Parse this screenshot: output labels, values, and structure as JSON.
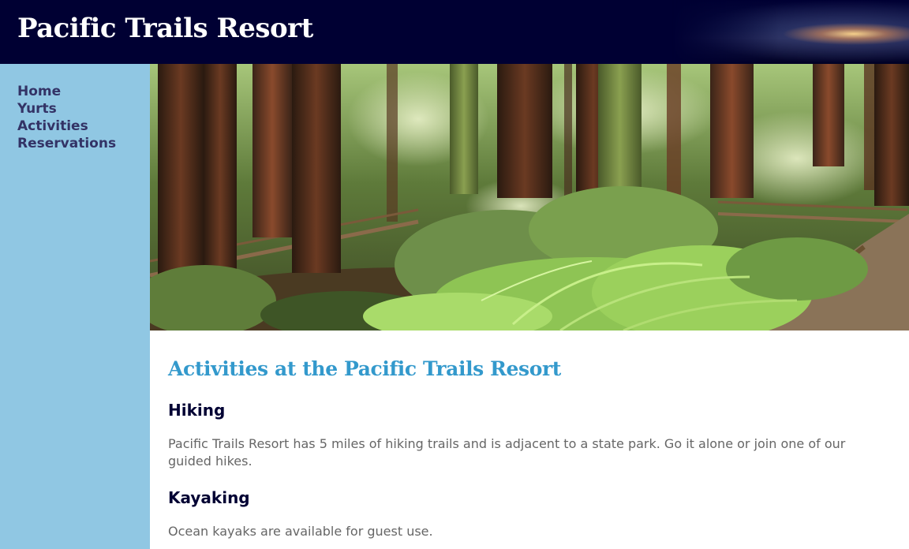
{
  "header": {
    "title": "Pacific Trails Resort"
  },
  "nav": {
    "items": [
      {
        "label": "Home"
      },
      {
        "label": "Yurts"
      },
      {
        "label": "Activities"
      },
      {
        "label": "Reservations"
      }
    ]
  },
  "hero": {
    "image": "redwood-forest-trail-image"
  },
  "main": {
    "heading": "Activities at the Pacific Trails Resort",
    "sections": [
      {
        "title": "Hiking",
        "text": "Pacific Trails Resort has 5 miles of hiking trails and is adjacent to a state park. Go it alone or join one of our guided hikes."
      },
      {
        "title": "Kayaking",
        "text": "Ocean kayaks are available for guest use."
      }
    ]
  },
  "colors": {
    "header_bg": "#000033",
    "sidebar_bg": "#90c7e3",
    "nav_link": "#333366",
    "heading": "#3399cc",
    "subheading": "#000033",
    "body_text": "#666666"
  }
}
